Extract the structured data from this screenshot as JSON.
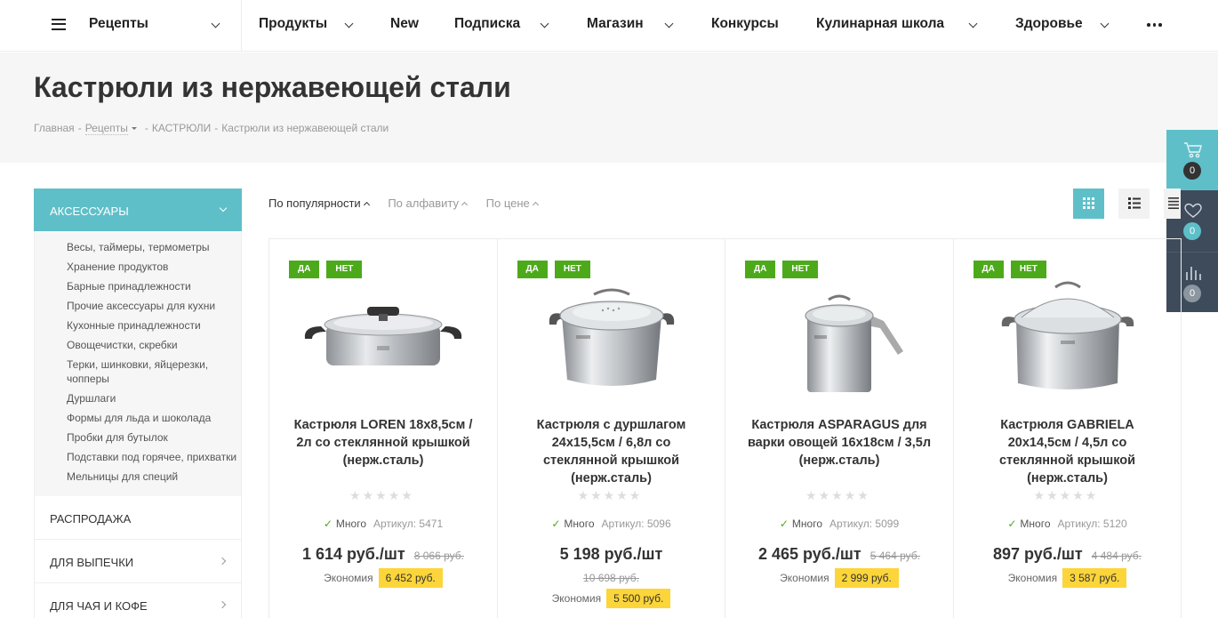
{
  "nav": {
    "recipes": "Рецепты",
    "items": [
      {
        "label": "Продукты",
        "has_dropdown": true
      },
      {
        "label": "New",
        "has_dropdown": false
      },
      {
        "label": "Подписка",
        "has_dropdown": true
      },
      {
        "label": "Магазин",
        "has_dropdown": true
      },
      {
        "label": "Конкурсы",
        "has_dropdown": false
      },
      {
        "label": "Кулинарная школа",
        "has_dropdown": true
      },
      {
        "label": "Здоровье",
        "has_dropdown": true
      }
    ]
  },
  "page": {
    "title": "Кастрюли из нержавеющей стали",
    "breadcrumbs": [
      "Главная",
      "Рецепты",
      "КАСТРЮЛИ",
      "Кастрюли из нержавеющей стали"
    ]
  },
  "float_panel": {
    "cart_count": "0",
    "favorites_count": "0",
    "compare_count": "0"
  },
  "sidebar": {
    "active_category": "АКСЕССУАРЫ",
    "subitems": [
      "Весы, таймеры, термометры",
      "Хранение продуктов",
      "Барные принадлежности",
      "Прочие аксессуары для кухни",
      "Кухонные принадлежности",
      "Овощечистки, скребки",
      "Терки, шинковки, яйцерезки, чопперы",
      "Дуршлаги",
      "Формы для льда и шоколада",
      "Пробки для бутылок",
      "Подставки под горячее, прихватки",
      "Мельницы для специй"
    ],
    "categories": [
      "РАСПРОДАЖА",
      "ДЛЯ ВЫПЕЧКИ",
      "ДЛЯ ЧАЯ И КОФЕ"
    ]
  },
  "sort": {
    "options": [
      "По популярности",
      "По алфавиту",
      "По цене"
    ],
    "active": "По популярности"
  },
  "products": [
    {
      "badges": [
        "ДА",
        "НЕТ"
      ],
      "name": "Кастрюля LOREN 18х8,5см / 2л со стеклянной крышкой (нерж.сталь)",
      "rating": 0,
      "stock": "Много",
      "article": "Артикул: 5471",
      "price": "1 614 руб./шт",
      "old_price": "8 066 руб.",
      "savings_label": "Экономия",
      "savings": "6 452 руб."
    },
    {
      "badges": [
        "ДА",
        "НЕТ"
      ],
      "name": "Кастрюля с дуршлагом 24х15,5см / 6,8л со стеклянной крышкой (нерж.сталь)",
      "rating": 0,
      "stock": "Много",
      "article": "Артикул: 5096",
      "price": "5 198 руб./шт",
      "old_price": "10 698 руб.",
      "savings_label": "Экономия",
      "savings": "5 500 руб."
    },
    {
      "badges": [
        "ДА",
        "НЕТ"
      ],
      "name": "Кастрюля ASPARAGUS для варки овощей 16х18см / 3,5л (нерж.сталь)",
      "rating": 0,
      "stock": "Много",
      "article": "Артикул: 5099",
      "price": "2 465 руб./шт",
      "old_price": "5 464 руб.",
      "savings_label": "Экономия",
      "savings": "2 999 руб."
    },
    {
      "badges": [
        "ДА",
        "НЕТ"
      ],
      "name": "Кастрюля GABRIELA 20х14,5см / 4,5л со стеклянной крышкой (нерж.сталь)",
      "rating": 0,
      "stock": "Много",
      "article": "Артикул: 5120",
      "price": "897 руб./шт",
      "old_price": "4 484 руб.",
      "savings_label": "Экономия",
      "savings": "3 587 руб."
    }
  ]
}
